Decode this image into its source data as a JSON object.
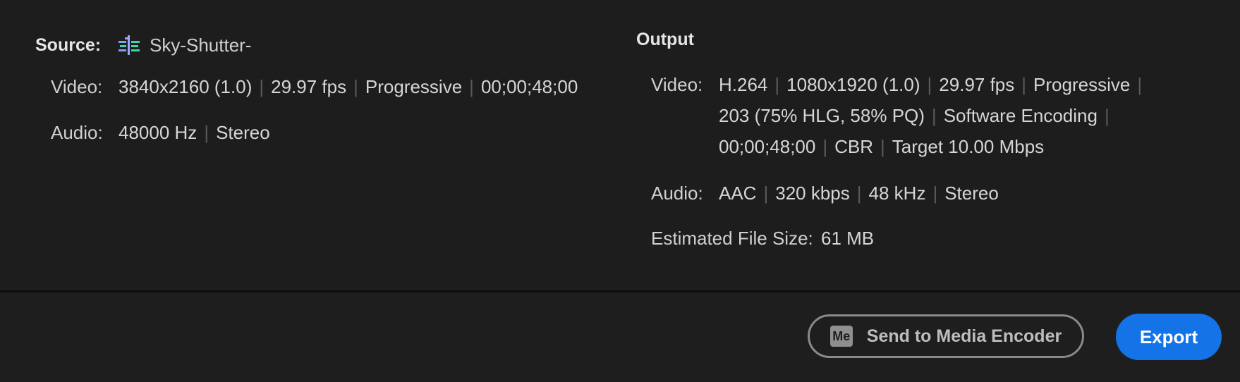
{
  "source": {
    "label": "Source:",
    "icon": "sequence-icon",
    "name": "Sky-Shutter-",
    "video_label": "Video:",
    "video": [
      "3840x2160 (1.0)",
      "29.97 fps",
      "Progressive",
      "00;00;48;00"
    ],
    "audio_label": "Audio:",
    "audio": [
      "48000 Hz",
      "Stereo"
    ]
  },
  "output": {
    "title": "Output",
    "video_label": "Video:",
    "video": [
      "H.264",
      "1080x1920 (1.0)",
      "29.97 fps",
      "Progressive",
      "203 (75% HLG, 58% PQ)",
      "Software Encoding",
      "00;00;48;00",
      "CBR",
      "Target 10.00 Mbps"
    ],
    "audio_label": "Audio:",
    "audio": [
      "AAC",
      "320 kbps",
      "48 kHz",
      "Stereo"
    ],
    "file_size_label": "Estimated File Size:",
    "file_size": "61 MB"
  },
  "buttons": {
    "media_encoder_badge": "Me",
    "media_encoder_label": "Send to Media Encoder",
    "export_label": "Export"
  },
  "colors": {
    "background": "#1e1e1e",
    "accent": "#1473e6"
  }
}
